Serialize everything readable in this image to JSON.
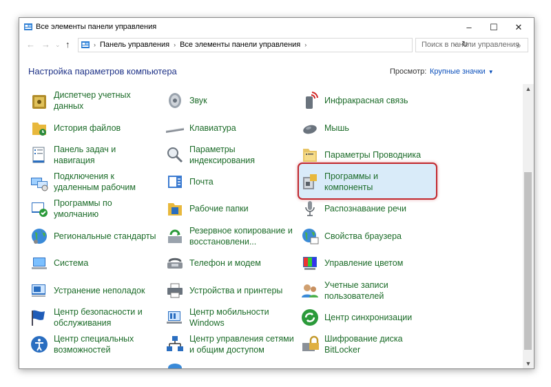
{
  "window": {
    "title": "Все элементы панели управления",
    "controls": {
      "minimize": "–",
      "maximize": "☐",
      "close": "✕"
    }
  },
  "nav": {
    "breadcrumbs": [
      "Панель управления",
      "Все элементы панели управления"
    ],
    "search_placeholder": "Поиск в панели управления"
  },
  "content": {
    "title": "Настройка параметров компьютера",
    "view_label": "Просмотр:",
    "view_value": "Крупные значки"
  },
  "items": [
    {
      "label": "Диспетчер учетных данных",
      "icon": "vault-icon"
    },
    {
      "label": "История файлов",
      "icon": "file-history-icon"
    },
    {
      "label": "Панель задач и навигация",
      "icon": "taskbar-icon"
    },
    {
      "label": "Подключения к удаленным рабочим",
      "icon": "remote-desktop-icon"
    },
    {
      "label": "Программы по умолчанию",
      "icon": "default-programs-icon"
    },
    {
      "label": "Региональные стандарты",
      "icon": "region-icon"
    },
    {
      "label": "Система",
      "icon": "system-icon"
    },
    {
      "label": "Устранение неполадок",
      "icon": "troubleshooting-icon"
    },
    {
      "label": "Центр безопасности и обслуживания",
      "icon": "security-flag-icon"
    },
    {
      "label": "Центр специальных возможностей",
      "icon": "accessibility-icon"
    },
    {
      "label": "Звук",
      "icon": "speaker-icon"
    },
    {
      "label": "Клавиатура",
      "icon": "keyboard-icon"
    },
    {
      "label": "Параметры индексирования",
      "icon": "indexing-icon"
    },
    {
      "label": "Почта",
      "icon": "mail-icon"
    },
    {
      "label": "Рабочие папки",
      "icon": "work-folders-icon"
    },
    {
      "label": "Резервное копирование и восстановлени...",
      "icon": "backup-icon"
    },
    {
      "label": "Телефон и модем",
      "icon": "phone-modem-icon"
    },
    {
      "label": "Устройства и принтеры",
      "icon": "printer-icon"
    },
    {
      "label": "Центр мобильности Windows",
      "icon": "mobility-icon"
    },
    {
      "label": "Центр управления сетями и общим доступом",
      "icon": "network-icon"
    },
    {
      "label": "Инфракрасная связь",
      "icon": "infrared-icon"
    },
    {
      "label": "Мышь",
      "icon": "mouse-icon"
    },
    {
      "label": "Параметры Проводника",
      "icon": "explorer-options-icon"
    },
    {
      "label": "Программы и компоненты",
      "icon": "programs-icon"
    },
    {
      "label": "Распознавание речи",
      "icon": "microphone-icon"
    },
    {
      "label": "Свойства браузера",
      "icon": "browser-icon"
    },
    {
      "label": "Управление цветом",
      "icon": "color-management-icon"
    },
    {
      "label": "Учетные записи пользователей",
      "icon": "user-accounts-icon"
    },
    {
      "label": "Центр синхронизации",
      "icon": "sync-icon"
    },
    {
      "label": "Шифрование диска BitLocker",
      "icon": "bitlocker-icon"
    }
  ],
  "highlighted_item": "Программы и компоненты",
  "colors": {
    "link_green": "#1b6b28",
    "title_blue": "#1e3287",
    "highlight_border": "#c1272d",
    "highlight_fill": "#d9ebf9"
  }
}
